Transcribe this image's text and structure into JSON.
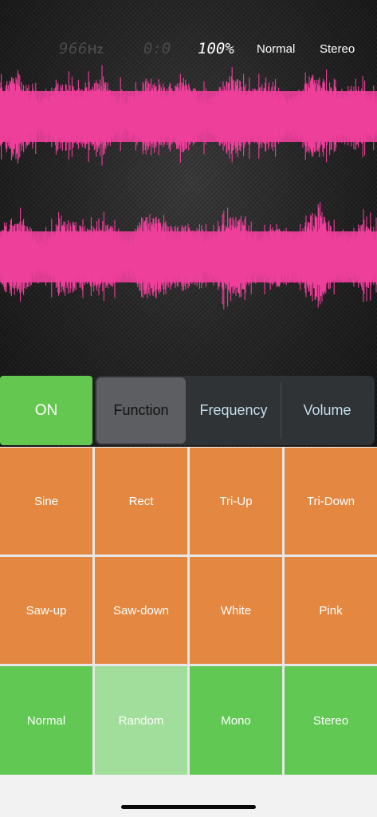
{
  "status": {
    "frequency": "966",
    "frequency_unit": "Hz",
    "time": "0:0",
    "volume": "100%",
    "mode": "Normal",
    "channel": "Stereo"
  },
  "colors": {
    "waveform": "#ee3f9b",
    "on_button": "#64c850",
    "function_cells": "#e48841",
    "mode_cells": "#61c853",
    "mode_cell_selected": "#a2de9b",
    "segment_text": "#c3ddec"
  },
  "controls": {
    "on_label": "ON",
    "segments": [
      {
        "label": "Function",
        "selected": true
      },
      {
        "label": "Frequency",
        "selected": false
      },
      {
        "label": "Volume",
        "selected": false
      }
    ]
  },
  "grid": {
    "row1": [
      "Sine",
      "Rect",
      "Tri-Up",
      "Tri-Down"
    ],
    "row2": [
      "Saw-up",
      "Saw-down",
      "White",
      "Pink"
    ],
    "row3": [
      "Normal",
      "Random",
      "Mono",
      "Stereo"
    ],
    "row3_selected": "Random"
  }
}
